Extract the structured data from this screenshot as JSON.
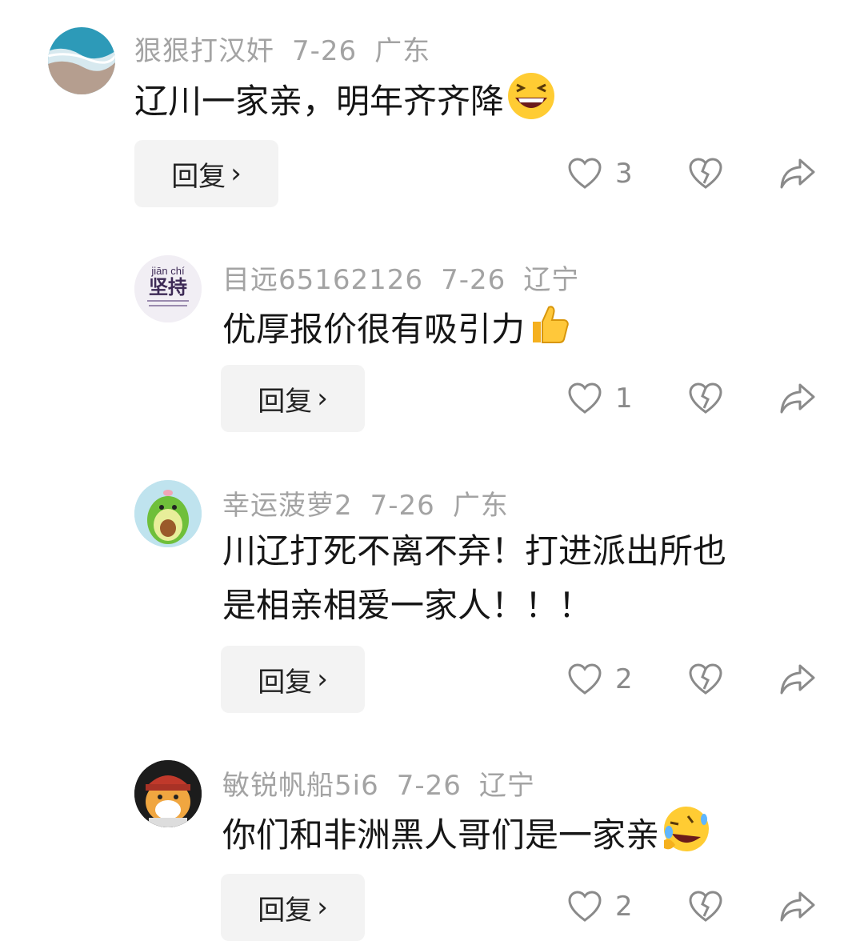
{
  "comments": [
    {
      "user": "狠狠打汉奸",
      "date": "7-26",
      "location": "广东",
      "text": "辽川一家亲，明年齐齐降",
      "emoji": "grinning-squinting-face",
      "reply_label": "回复",
      "likes": "3"
    },
    {
      "user": "目远65162126",
      "date": "7-26",
      "location": "辽宁",
      "text": "优厚报价很有吸引力",
      "emoji": "thumbs-up",
      "reply_label": "回复",
      "likes": "1",
      "avatar_pinyin": "jiān chí",
      "avatar_title": "坚持"
    },
    {
      "user": "幸运菠萝2",
      "date": "7-26",
      "location": "广东",
      "text_line1": "川辽打死不离不弃！打进派出所也",
      "text_line2": "是相亲相爱一家人！！！",
      "reply_label": "回复",
      "likes": "2"
    },
    {
      "user": "敏锐帆船5i6",
      "date": "7-26",
      "location": "辽宁",
      "text": "你们和非洲黑人哥们是一家亲",
      "emoji": "rolling-on-floor-laughing",
      "reply_label": "回复",
      "likes": "2"
    }
  ],
  "colors": {
    "meta": "#a3a3a3",
    "text": "#161616",
    "reply_bg": "#f3f3f3",
    "icon": "#888888"
  }
}
